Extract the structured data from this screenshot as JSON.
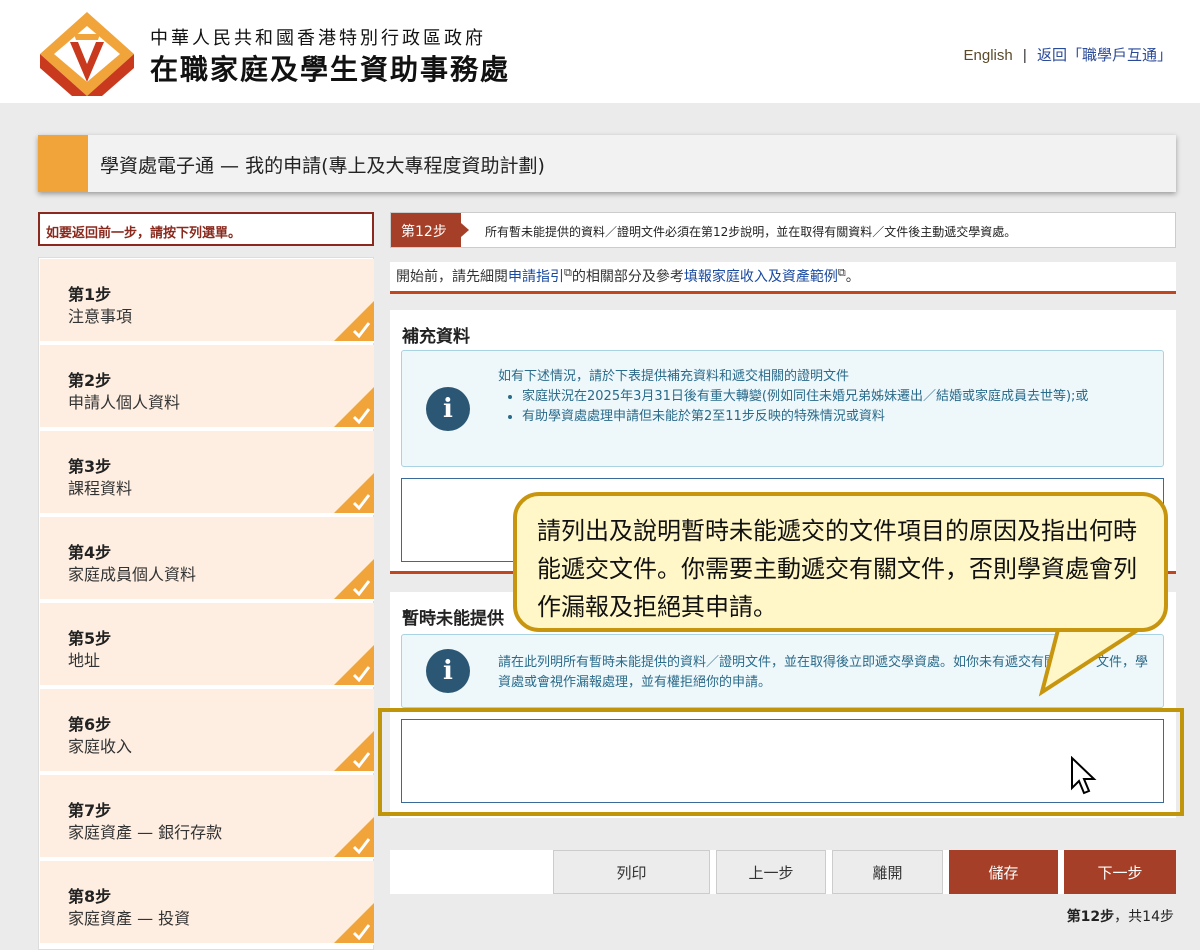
{
  "header": {
    "dept_line1": "中華人民共和國香港特別行政區政府",
    "dept_line2": "在職家庭及學生資助事務處",
    "lang_link": "English",
    "separator": "|",
    "back_link": "返回「職學戶互通」"
  },
  "title": "學資處電子通 — 我的申請(專上及大專程度資助計劃)",
  "sidebar": {
    "back_note": "如要返回前一步，請按下列選單。",
    "steps": [
      {
        "num": "第1步",
        "name": "注意事項"
      },
      {
        "num": "第2步",
        "name": "申請人個人資料"
      },
      {
        "num": "第3步",
        "name": "課程資料"
      },
      {
        "num": "第4步",
        "name": "家庭成員個人資料"
      },
      {
        "num": "第5步",
        "name": "地址"
      },
      {
        "num": "第6步",
        "name": "家庭收入"
      },
      {
        "num": "第7步",
        "name": "家庭資產 — 銀行存款"
      },
      {
        "num": "第8步",
        "name": "家庭資產 — 投資"
      }
    ]
  },
  "step_bar": {
    "tag": "第12步",
    "message": "所有暫未能提供的資料／證明文件必須在第12步說明，並在取得有關資料／文件後主動遞交學資處。"
  },
  "intro": {
    "prefix": "開始前，請先細閱",
    "link1": "申請指引",
    "middle": "的相關部分及參考",
    "link2": "填報家庭收入及資產範例",
    "suffix": "。"
  },
  "section1": {
    "title": "補充資料",
    "info_lead": "如有下述情況，請於下表提供補充資料和遞交相關的證明文件",
    "bullets": [
      "家庭狀況在2025年3月31日後有重大轉變(例如同住未婚兄弟姊妹遷出／結婚或家庭成員去世等);或",
      "有助學資處處理申請但未能於第2至11步反映的特殊情況或資料"
    ]
  },
  "section2": {
    "title": "暫時未能提供",
    "info_text": "請在此列明所有暫時未能提供的資料／證明文件，並在取得後立即遞交學資處。如你未有遞交有關資料／文件，學資處或會視作漏報處理，並有權拒絕你的申請。"
  },
  "callout": "請列出及說明暫時未能遞交的文件項目的原因及指出何時能遞交文件。你需要主動遞交有關文件，否則學資處會列作漏報及拒絕其申請。",
  "buttons": {
    "print": "列印",
    "prev": "上一步",
    "leave": "離開",
    "save": "儲存",
    "next": "下一步"
  },
  "page_count": {
    "current": "第12步",
    "total": "，共14步"
  },
  "colors": {
    "accent_orange": "#f0a43a",
    "brand_red": "#a63f27",
    "callout_border": "#c8950e"
  }
}
